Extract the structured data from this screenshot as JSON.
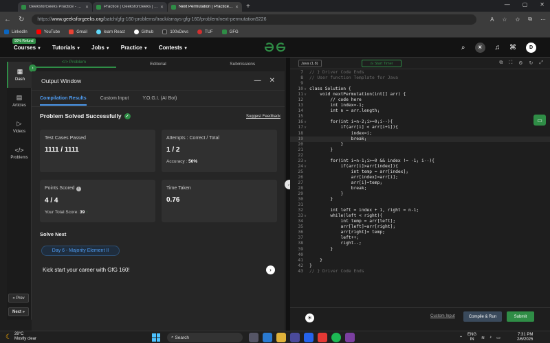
{
  "browser": {
    "tabs": [
      {
        "title": "GeeksforGeeks Practice - Leading Online Coding Platform",
        "active": false
      },
      {
        "title": "Practice | GeeksforGeeks | A computer science portal",
        "active": false
      },
      {
        "title": "Next Permutation | Practice | GeeksforGeeks",
        "active": true
      }
    ],
    "url_prefix": "https://",
    "url_host": "www.geeksforgeeks.org",
    "url_path": "/batch/gfg-160-problems/track/arrays-gfg-160/problem/next-permutation5226",
    "bookmarks": [
      "LinkedIn",
      "YouTube",
      "Gmail",
      "learn React",
      "Github",
      "100xDevs",
      "TUF",
      "GFG"
    ]
  },
  "gfg_header": {
    "refund_badge": "90% Refund",
    "nav": [
      "Courses",
      "Tutorials",
      "Jobs",
      "Practice",
      "Contests"
    ],
    "logo_text": "GfG",
    "avatar_initial": "D"
  },
  "rail": {
    "items": [
      {
        "label": "Dash",
        "icon": "dashboard-icon",
        "active": true
      },
      {
        "label": "Articles",
        "icon": "articles-icon",
        "active": false
      },
      {
        "label": "Videos",
        "icon": "video-icon",
        "active": false
      },
      {
        "label": "Problems",
        "icon": "code-icon",
        "active": false
      }
    ],
    "prev_label": "« Prev",
    "next_label": "Next »"
  },
  "problem_tabs": [
    "</> Problem",
    "Editorial",
    "Submissions"
  ],
  "output": {
    "title": "Output Window",
    "tabs": [
      "Compilation Results",
      "Custom Input",
      "Y.O.G.I. (AI Bot)"
    ],
    "status": "Problem Solved Successfully",
    "feedback": "Suggest Feedback",
    "cards": {
      "tests_label": "Test Cases Passed",
      "tests_value": "1111 / 1111",
      "attempts_label": "Attempts : Correct / Total",
      "attempts_value": "1 / 2",
      "accuracy_label": "Accuracy :",
      "accuracy_value": "50%",
      "points_label": "Points Scored",
      "points_value": "4 / 4",
      "total_label": "Your Total Score:",
      "total_value": "39",
      "time_label": "Time Taken",
      "time_value": "0.76"
    },
    "solve_next": "Solve Next",
    "next_problem": "Day 6 - Majority Element II",
    "kickstart": "Kick start your career with GfG 160!"
  },
  "editor": {
    "language": "Java (1.8)",
    "timer": "Start Timer",
    "custom_input": "Custom Input",
    "compile": "Compile & Run",
    "submit": "Submit",
    "lines": [
      {
        "n": "7",
        "t": "// } Driver Code Ends",
        "fold": "",
        "sel": true
      },
      {
        "n": "8",
        "t": "// User function Template for Java",
        "fold": "",
        "sel": true
      },
      {
        "n": "9",
        "t": "",
        "fold": ""
      },
      {
        "n": "10",
        "t": "class Solution {",
        "fold": "v"
      },
      {
        "n": "11",
        "t": "    void nextPermutation(int[] arr) {",
        "fold": "v"
      },
      {
        "n": "12",
        "t": "        // code here",
        "fold": ""
      },
      {
        "n": "13",
        "t": "        int index=-1;",
        "fold": ""
      },
      {
        "n": "14",
        "t": "        int n = arr.length;",
        "fold": ""
      },
      {
        "n": "15",
        "t": "",
        "fold": ""
      },
      {
        "n": "16",
        "t": "        for(int i=n-2;i>=0;i--){",
        "fold": "v"
      },
      {
        "n": "17",
        "t": "            if(arr[i] < arr[i+1]){",
        "fold": "v"
      },
      {
        "n": "18",
        "t": "                index=i;",
        "fold": ""
      },
      {
        "n": "19",
        "t": "                break;",
        "fold": "",
        "hl": true
      },
      {
        "n": "20",
        "t": "            }",
        "fold": ""
      },
      {
        "n": "21",
        "t": "        }",
        "fold": ""
      },
      {
        "n": "22",
        "t": "",
        "fold": ""
      },
      {
        "n": "23",
        "t": "        for(int i=n-1;i>=0 && index != -1; i--){",
        "fold": "v"
      },
      {
        "n": "24",
        "t": "            if(arr[i]>arr[index]){",
        "fold": "v"
      },
      {
        "n": "25",
        "t": "                int temp = arr[index];",
        "fold": ""
      },
      {
        "n": "26",
        "t": "                arr[index]=arr[i];",
        "fold": ""
      },
      {
        "n": "27",
        "t": "                arr[i]=temp;",
        "fold": ""
      },
      {
        "n": "28",
        "t": "                break;",
        "fold": ""
      },
      {
        "n": "29",
        "t": "            }",
        "fold": ""
      },
      {
        "n": "30",
        "t": "        }",
        "fold": ""
      },
      {
        "n": "31",
        "t": "",
        "fold": ""
      },
      {
        "n": "32",
        "t": "        int left = index + 1, right = n-1;",
        "fold": ""
      },
      {
        "n": "33",
        "t": "        while(left < right){",
        "fold": "v"
      },
      {
        "n": "34",
        "t": "            int temp = arr[left];",
        "fold": ""
      },
      {
        "n": "35",
        "t": "            arr[left]=arr[right];",
        "fold": ""
      },
      {
        "n": "36",
        "t": "            arr[right]= temp;",
        "fold": ""
      },
      {
        "n": "37",
        "t": "            left++;",
        "fold": ""
      },
      {
        "n": "38",
        "t": "            right--;",
        "fold": ""
      },
      {
        "n": "39",
        "t": "        }",
        "fold": ""
      },
      {
        "n": "40",
        "t": "",
        "fold": ""
      },
      {
        "n": "41",
        "t": "    }",
        "fold": ""
      },
      {
        "n": "42",
        "t": "}",
        "fold": ""
      },
      {
        "n": "43",
        "t": "// } Driver Code Ends",
        "fold": "",
        "sel": true
      }
    ]
  },
  "taskbar": {
    "temp": "28°C",
    "weather": "Mostly clear",
    "search": "Search",
    "lang_top": "ENG",
    "lang_bottom": "IN",
    "time": "7:31 PM",
    "date": "2/6/2025"
  },
  "colors": {
    "brand": "#2f8d46",
    "link": "#4e9bf0"
  }
}
